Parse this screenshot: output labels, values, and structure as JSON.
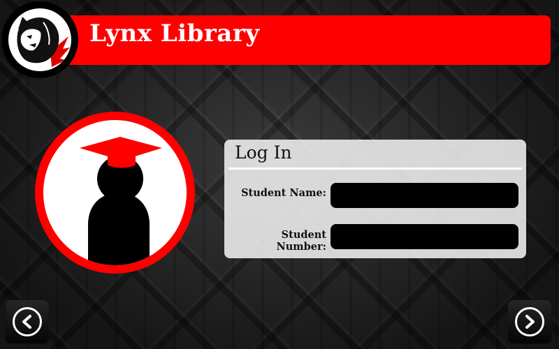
{
  "header": {
    "title": "Lynx Library"
  },
  "login": {
    "title": "Log In",
    "student_name_label": "Student Name:",
    "student_name_value": "",
    "student_number_label": "Student Number:",
    "student_number_value": ""
  },
  "colors": {
    "accent": "#ff0000",
    "panel": "#efefef",
    "input": "#000000"
  },
  "icons": {
    "logo": "lynx-cat-logo-icon",
    "avatar": "graduate-student-icon",
    "back": "chevron-left-icon",
    "next": "chevron-right-icon"
  }
}
